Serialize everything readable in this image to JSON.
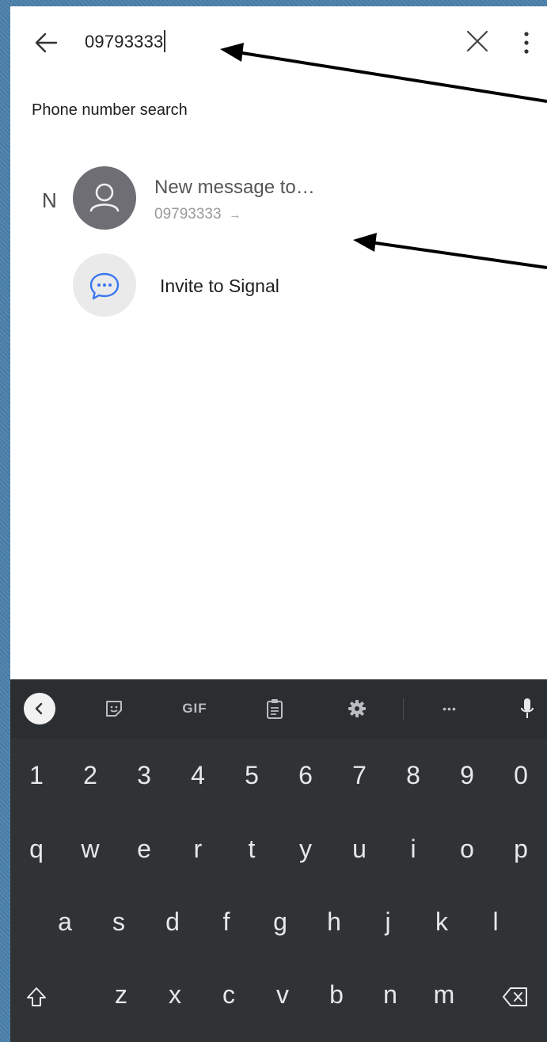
{
  "search": {
    "query": "09793333"
  },
  "results": {
    "section_header": "Phone number search",
    "index_letter": "N",
    "new_message_title": "New message to…",
    "new_message_number": "09793333",
    "new_message_arrow": "→",
    "invite_label": "Invite to Signal"
  },
  "keyboard": {
    "toolbar": {
      "gif_label": "GIF",
      "more_label": "•••"
    },
    "row_numbers": [
      "1",
      "2",
      "3",
      "4",
      "5",
      "6",
      "7",
      "8",
      "9",
      "0"
    ],
    "row_top": [
      "q",
      "w",
      "e",
      "r",
      "t",
      "y",
      "u",
      "i",
      "o",
      "p"
    ],
    "row_middle": [
      "a",
      "s",
      "d",
      "f",
      "g",
      "h",
      "j",
      "k",
      "l"
    ],
    "row_bottom": [
      "z",
      "x",
      "c",
      "v",
      "b",
      "n",
      "m"
    ]
  },
  "icons": {
    "back": "arrow-left-icon",
    "clear": "close-icon",
    "overflow": "more-vert-icon",
    "avatar": "person-icon",
    "invite": "chat-bubble-icon",
    "kb_collapse": "chevron-left-icon",
    "sticker": "sticker-icon",
    "clipboard": "clipboard-icon",
    "settings": "settings-gear-icon",
    "mic": "microphone-icon",
    "shift": "shift-icon",
    "backspace": "backspace-icon"
  },
  "colors": {
    "frame": "#4b82ad",
    "avatar_bg": "#6e6e74",
    "invite_icon": "#3a76f0",
    "keyboard_bg": "#303336"
  }
}
